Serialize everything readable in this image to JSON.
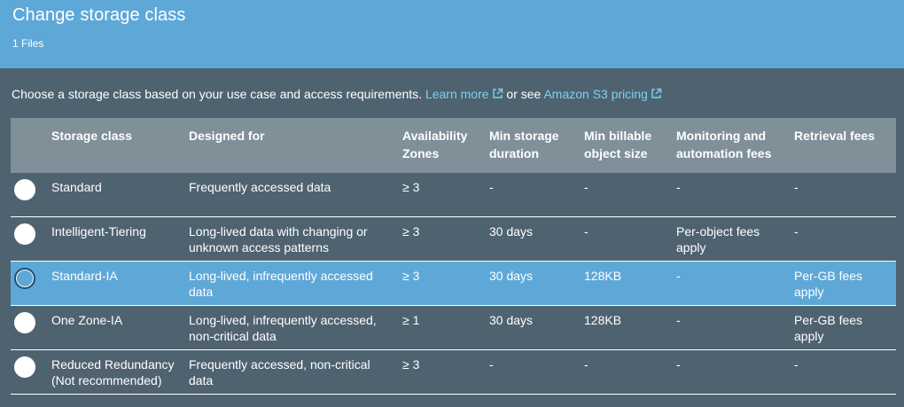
{
  "header": {
    "title": "Change storage class",
    "subtitle": "1 Files"
  },
  "intro": {
    "text": "Choose a storage class based on your use case and access requirements.",
    "learn_more": "Learn more",
    "or_see": "or see",
    "pricing": "Amazon S3 pricing"
  },
  "table": {
    "headers": [
      "Storage class",
      "Designed for",
      "Availability Zones",
      "Min storage duration",
      "Min billable object size",
      "Monitoring and automation fees",
      "Retrieval fees"
    ],
    "rows": [
      {
        "storage_class": "Standard",
        "designed_for": "Frequently accessed data",
        "zones": "≥ 3",
        "min_duration": "-",
        "min_size": "-",
        "monitoring": "-",
        "retrieval": "-",
        "selected": false
      },
      {
        "storage_class": "Intelligent-Tiering",
        "designed_for": "Long-lived data with changing or unknown access patterns",
        "zones": "≥ 3",
        "min_duration": "30 days",
        "min_size": "-",
        "monitoring": "Per-object fees apply",
        "retrieval": "-",
        "selected": false
      },
      {
        "storage_class": "Standard-IA",
        "designed_for": "Long-lived, infrequently accessed data",
        "zones": "≥ 3",
        "min_duration": "30 days",
        "min_size": "128KB",
        "monitoring": "-",
        "retrieval": "Per-GB fees apply",
        "selected": true
      },
      {
        "storage_class": "One Zone-IA",
        "designed_for": "Long-lived, infrequently accessed, non-critical data",
        "zones": "≥ 1",
        "min_duration": "30 days",
        "min_size": "128KB",
        "monitoring": "-",
        "retrieval": "Per-GB fees apply",
        "selected": false
      },
      {
        "storage_class": "Reduced Redundancy (Not recommended)",
        "designed_for": "Frequently accessed, non-critical data",
        "zones": "≥ 3",
        "min_duration": "-",
        "min_size": "-",
        "monitoring": "-",
        "retrieval": "-",
        "selected": false
      }
    ]
  },
  "colors": {
    "header_bg": "#5ea8d8",
    "body_bg": "#4f6270",
    "table_header_bg": "#7f9099",
    "selected_row_bg": "#5ea8d8",
    "link": "#7fd0f5"
  },
  "icons": [
    "external-link-icon",
    "radio-button"
  ]
}
